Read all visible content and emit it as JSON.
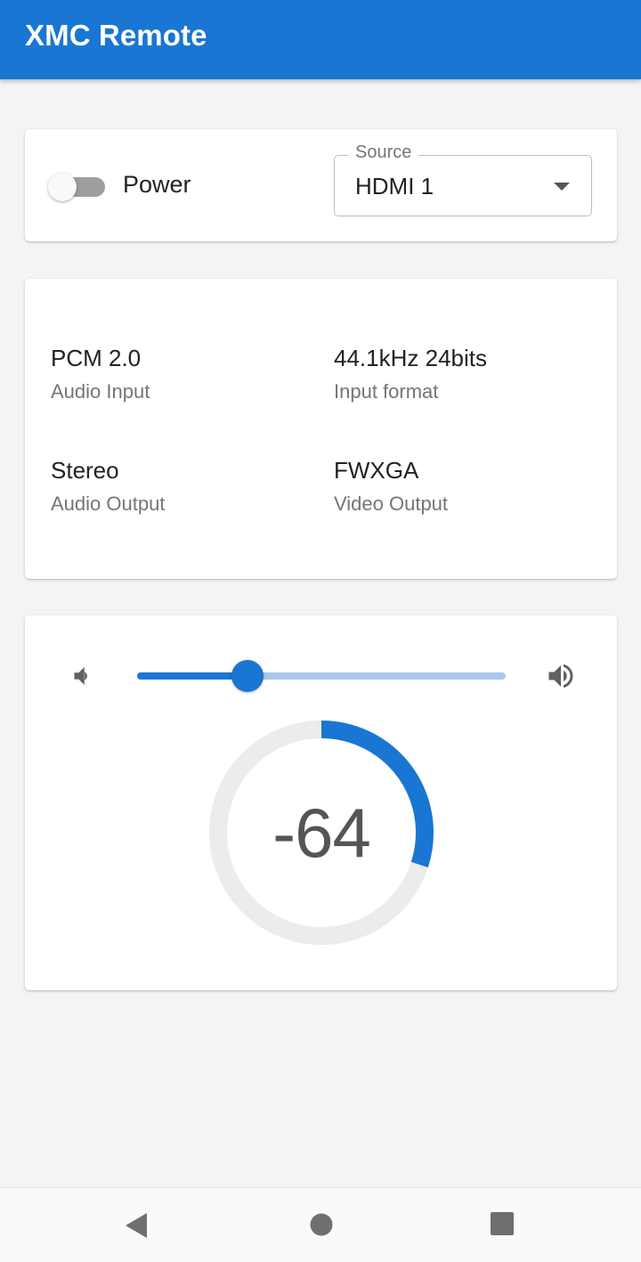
{
  "appbar": {
    "title": "XMC Remote"
  },
  "controls": {
    "power": {
      "label": "Power",
      "on": false
    },
    "source": {
      "legend": "Source",
      "value": "HDMI 1"
    }
  },
  "info": [
    {
      "value": "PCM 2.0",
      "label": "Audio Input"
    },
    {
      "value": "44.1kHz 24bits",
      "label": "Input format"
    },
    {
      "value": "Stereo",
      "label": "Audio Output"
    },
    {
      "value": "FWXGA",
      "label": "Video Output"
    }
  ],
  "volume": {
    "display": "-64",
    "slider_fraction": 0.3,
    "gauge_fraction": 0.3,
    "icons": [
      "volume-down-icon",
      "volume-up-icon"
    ]
  },
  "navbar": {
    "icons": [
      "back-icon",
      "home-icon",
      "recents-icon"
    ]
  },
  "colors": {
    "primary": "#1976d2",
    "rail": "#a7c9ee",
    "gauge_bg": "#ececec"
  }
}
